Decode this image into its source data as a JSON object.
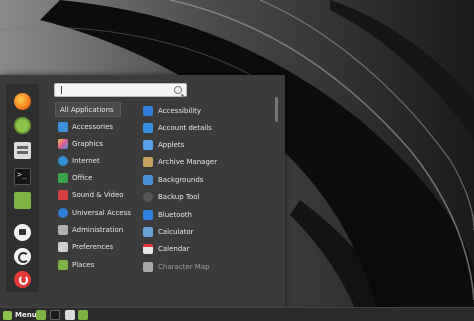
{
  "search": {
    "value": ""
  },
  "favorites": [
    {
      "name": "firefox-icon"
    },
    {
      "name": "software-manager-icon"
    },
    {
      "name": "settings-icon"
    },
    {
      "name": "terminal-icon"
    },
    {
      "name": "files-icon"
    },
    {
      "name": "lock-icon"
    },
    {
      "name": "logout-icon"
    },
    {
      "name": "power-icon"
    }
  ],
  "categories": [
    {
      "label": "All Applications"
    },
    {
      "label": "Accessories",
      "color": "#3d8fe0"
    },
    {
      "label": "Graphics",
      "color": "#e05a9a"
    },
    {
      "label": "Internet",
      "color": "#2f8fd8"
    },
    {
      "label": "Office",
      "color": "#3aa44a"
    },
    {
      "label": "Sound & Video",
      "color": "#d84040"
    },
    {
      "label": "Universal Access",
      "color": "#2f7fd8"
    },
    {
      "label": "Administration",
      "color": "#b0b0b0"
    },
    {
      "label": "Preferences",
      "color": "#cfcfcf"
    },
    {
      "label": "Places",
      "color": "#7cb342"
    }
  ],
  "apps": [
    {
      "label": "Accessibility",
      "color": "#2f7fd8"
    },
    {
      "label": "Account details",
      "color": "#3a8fe0"
    },
    {
      "label": "Applets",
      "color": "#5aa0e8"
    },
    {
      "label": "Archive Manager",
      "color": "#c8a060"
    },
    {
      "label": "Backgrounds",
      "color": "#4a90d9"
    },
    {
      "label": "Backup Tool",
      "color": "#555555"
    },
    {
      "label": "Bluetooth",
      "color": "#3080e0"
    },
    {
      "label": "Calculator",
      "color": "#6aa0d8"
    },
    {
      "label": "Calendar",
      "color": "#e8e8e8"
    },
    {
      "label": "Character Map",
      "color": "#d8d8d8"
    }
  ],
  "taskbar": {
    "menu_label": "Menu"
  }
}
